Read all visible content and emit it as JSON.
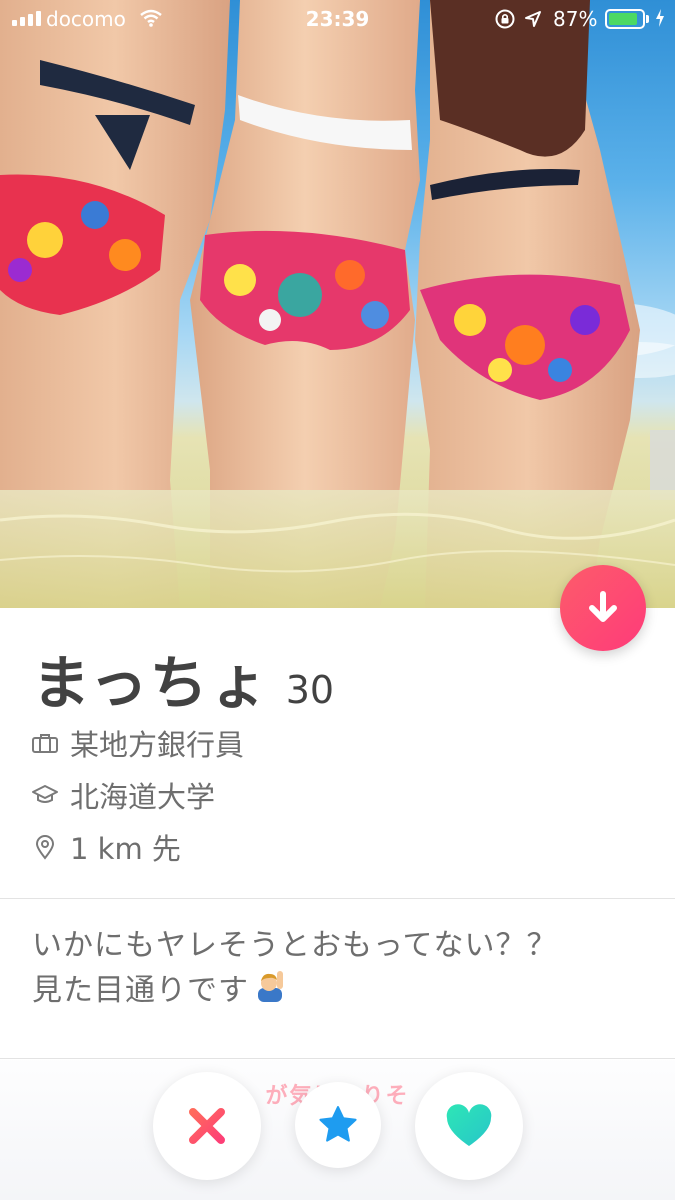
{
  "status_bar": {
    "carrier": "docomo",
    "time": "23:39",
    "battery_percent": "87%",
    "battery_level": 0.87,
    "battery_color": "#4cd964"
  },
  "profile": {
    "name": "まっちょ",
    "age": "30",
    "job": "某地方銀行員",
    "school": "北海道大学",
    "distance": "1 km 先",
    "bio_lines": [
      "いかにもヤレそうとおもってない？？",
      "見た目通りです"
    ],
    "bio_emoji": "raising-hand-emoji"
  },
  "bottom_bar": {
    "hint_text": "が気になりそ"
  },
  "icons": {
    "job": "briefcase-icon",
    "school": "graduation-cap-icon",
    "distance": "location-pin-icon",
    "down": "arrow-down-icon",
    "nope": "x-icon",
    "super_like": "star-icon",
    "like": "heart-icon"
  },
  "colors": {
    "accent": "#fe3c72",
    "nope": "#fd4a6a",
    "super_like": "#1e9cf0",
    "like": "#2ee6b6"
  }
}
